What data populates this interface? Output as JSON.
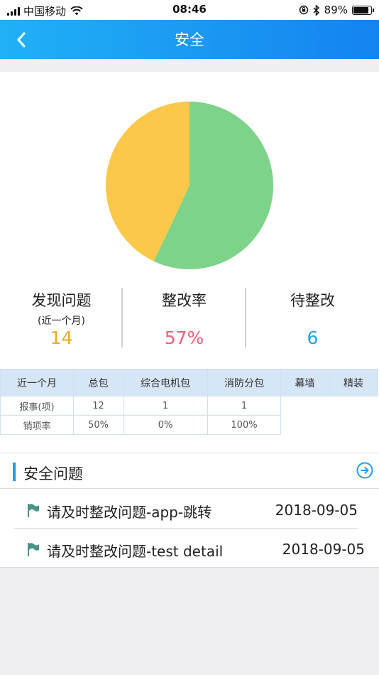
{
  "status_bar": {
    "carrier": "中国移动",
    "time": "08:46",
    "battery": "89%",
    "battery_level": 0.89
  },
  "header": {
    "title": "安全",
    "back_icon": "chevron-left-icon"
  },
  "chart_data": {
    "type": "pie",
    "title": "",
    "slices": [
      {
        "label": "",
        "value": 57,
        "color": "#7dd389"
      },
      {
        "label": "",
        "value": 43,
        "color": "#fbc84a"
      }
    ]
  },
  "stats": [
    {
      "label": "发现问题",
      "sub": "(近一个月)",
      "value": "14",
      "color": "#f5a623"
    },
    {
      "label": "整改率",
      "sub": "",
      "value": "57%",
      "color": "#f0607a"
    },
    {
      "label": "待整改",
      "sub": "",
      "value": "6",
      "color": "#1ea0ee"
    }
  ],
  "table": {
    "headers": [
      "近一个月",
      "总包",
      "综合电机包",
      "消防分包",
      "幕墙",
      "精装"
    ],
    "rows": [
      [
        "报事(项)",
        "12",
        "1",
        "1"
      ],
      [
        "销项率",
        "50%",
        "0%",
        "100%"
      ]
    ]
  },
  "section": {
    "title": "安全问题",
    "more_icon": "circle-arrow-right-icon",
    "accent": "#1e9bf0",
    "items": [
      {
        "title": "请及时整改问题-app-跳转",
        "date": "2018-09-05",
        "icon": "flag-icon"
      },
      {
        "title": "请及时整改问题-test detail",
        "date": "2018-09-05",
        "icon": "flag-icon"
      }
    ]
  }
}
